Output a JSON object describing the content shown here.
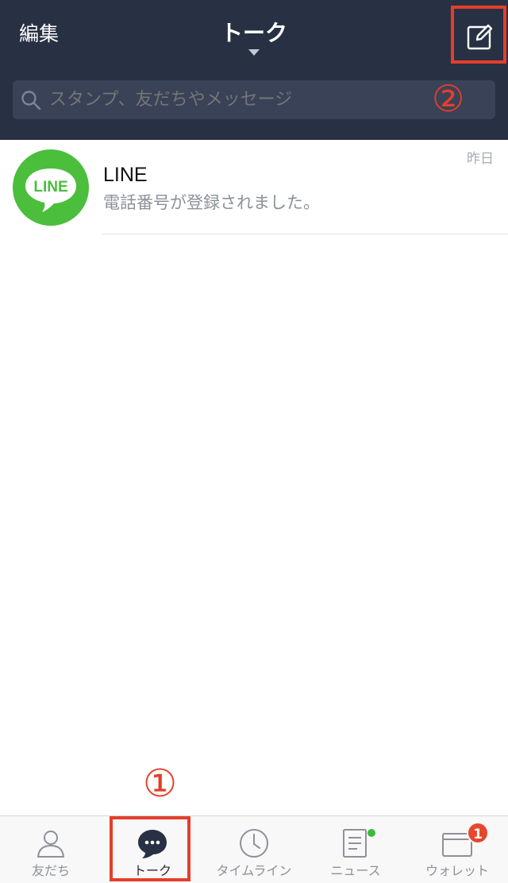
{
  "header": {
    "edit_label": "編集",
    "title": "トーク",
    "search_placeholder": "スタンプ、友だちやメッセージ"
  },
  "annotations": {
    "marker_1": "①",
    "marker_2": "②"
  },
  "chats": [
    {
      "avatar_text": "LINE",
      "name": "LINE",
      "preview": "電話番号が登録されました。",
      "time": "昨日"
    }
  ],
  "tabs": [
    {
      "label": "友だち",
      "icon": "person-icon",
      "active": false
    },
    {
      "label": "トーク",
      "icon": "chat-bubble-icon",
      "active": true
    },
    {
      "label": "タイムライン",
      "icon": "clock-icon",
      "active": false
    },
    {
      "label": "ニュース",
      "icon": "news-icon",
      "active": false,
      "dot": true
    },
    {
      "label": "ウォレット",
      "icon": "wallet-icon",
      "active": false,
      "badge": "1"
    }
  ],
  "colors": {
    "header_bg": "#283044",
    "search_bg": "#3a4258",
    "line_green": "#4bbe3c",
    "annotation_red": "#e53e2a",
    "badge_red": "#e8462f"
  }
}
